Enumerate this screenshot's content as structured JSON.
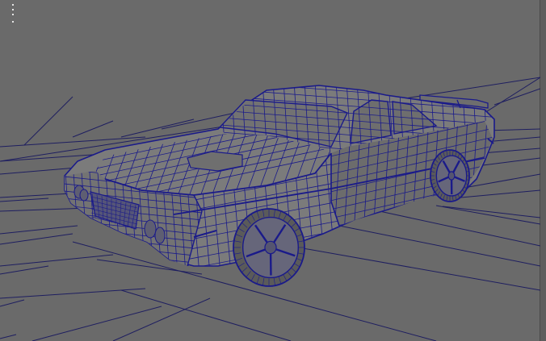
{
  "viewport": {
    "name": "perspective-viewport",
    "background": "#6a6a6a",
    "grid_color": "#1e1e60",
    "wire_color": "#1a1a8a",
    "mesh_fill": "#7b7b7b",
    "mesh_shadow": "#6c6c6c",
    "glass_fill": "#727272",
    "tire_fill": "#5a5a5a",
    "rim_fill": "#66667a"
  },
  "hud": {
    "marker_count": 4
  }
}
